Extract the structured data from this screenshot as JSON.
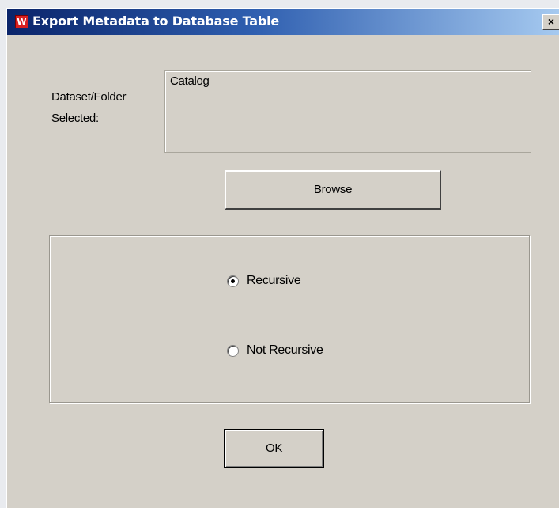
{
  "window": {
    "title": "Export Metadata to Database Table",
    "close_label": "X"
  },
  "dataset": {
    "label_line1": "Dataset/Folder",
    "label_line2": "Selected:",
    "value": "Catalog"
  },
  "buttons": {
    "browse": "Browse",
    "ok": "OK"
  },
  "options": {
    "recursive_label": "Recursive",
    "not_recursive_label": "Not Recursive",
    "selected": "Recursive"
  },
  "icons": {
    "app_icon": "app-logo-icon",
    "close_icon": "close-icon"
  },
  "colors": {
    "dialog_bg": "#d4d0c8",
    "titlebar_start": "#0a246a",
    "titlebar_end": "#a6caf0",
    "app_icon_red": "#d82020"
  }
}
